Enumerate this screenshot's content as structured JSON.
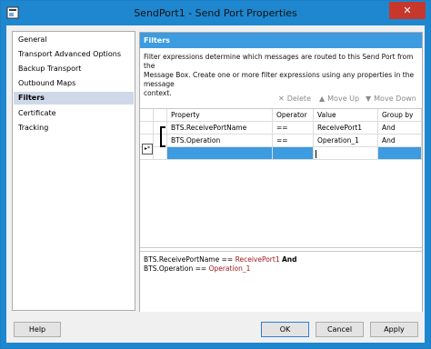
{
  "window": {
    "title": "SendPort1 - Send Port Properties",
    "close_glyph": "✕"
  },
  "nav": {
    "items": [
      {
        "label": "General"
      },
      {
        "label": "Transport Advanced Options"
      },
      {
        "label": "Backup Transport"
      },
      {
        "label": "Outbound Maps"
      },
      {
        "label": "Filters"
      },
      {
        "label": "Certificate"
      },
      {
        "label": "Tracking"
      }
    ],
    "selected": "Filters"
  },
  "panel": {
    "header": "Filters",
    "description_line1": "Filter expressions determine which messages are routed to this Send Port from the",
    "description_line2": "Message Box. Create one or more filter expressions using any properties in the message",
    "description_line3": "context.",
    "toolbar": {
      "delete_label": "Delete",
      "move_up_label": "Move Up",
      "move_down_label": "Move Down"
    },
    "grid": {
      "columns": [
        "Property",
        "Operator",
        "Value",
        "Group by"
      ],
      "rows": [
        {
          "property": "BTS.ReceivePortName",
          "operator": "==",
          "value": "ReceivePort1",
          "group_by": "And"
        },
        {
          "property": "BTS.Operation",
          "operator": "==",
          "value": "Operation_1",
          "group_by": "And"
        }
      ],
      "new_row_marker": "▸*"
    },
    "preview": {
      "line1_property": "BTS.ReceivePortName",
      "line1_operator": "==",
      "line1_value": "ReceivePort1",
      "line1_group": "And",
      "line2_property": "BTS.Operation",
      "line2_operator": "==",
      "line2_value": "Operation_1"
    }
  },
  "buttons": {
    "help": "Help",
    "ok": "OK",
    "cancel": "Cancel",
    "apply": "Apply"
  },
  "colors": {
    "title_bar": "#1e87cf",
    "panel_header": "#3d9be0",
    "close": "#c7372c",
    "selection": "#3d9be0"
  }
}
